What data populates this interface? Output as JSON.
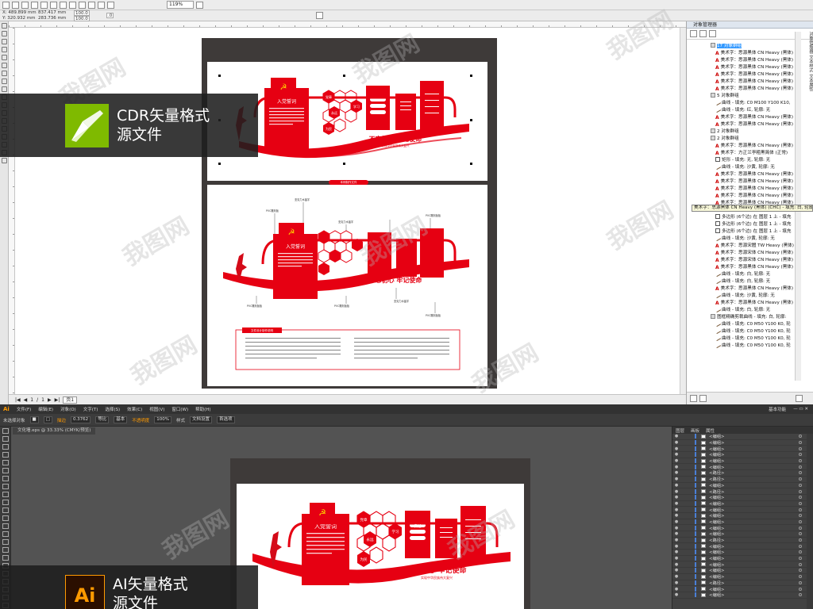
{
  "cdr": {
    "zoom": "119%",
    "coords": {
      "x": "X: 489.899 mm",
      "y": "Y: 320.932 mm",
      "w": "837.417 mm",
      "h": "283.736 mm"
    },
    "scale_a": "100.0",
    "scale_b": "100.0",
    "angle": ".0",
    "page_nav": {
      "current": "1",
      "separator": "/",
      "total": "1",
      "tab": "页1"
    },
    "object_manager": {
      "title": "对象管理器",
      "side_tabs": "对象管理器 文本样式 文本属性",
      "rows": [
        {
          "kind": "grp",
          "icon": "g",
          "text": "17 对象群组",
          "selected": true
        },
        {
          "kind": "item",
          "icon": "a",
          "text": "美术字：思源黑体 CN Heavy (黑体)"
        },
        {
          "kind": "item",
          "icon": "a",
          "text": "美术字：思源黑体 CN Heavy (黑体)"
        },
        {
          "kind": "item",
          "icon": "a",
          "text": "美术字：思源黑体 CN Heavy (黑体)"
        },
        {
          "kind": "item",
          "icon": "a",
          "text": "美术字：思源黑体 CN Heavy (黑体)"
        },
        {
          "kind": "item",
          "icon": "a",
          "text": "美术字：思源黑体 CN Heavy (黑体)"
        },
        {
          "kind": "item",
          "icon": "a",
          "text": "美术字：思源黑体 CN Heavy (黑体)"
        },
        {
          "kind": "grp",
          "icon": "g",
          "text": "5 对象群组"
        },
        {
          "kind": "item",
          "icon": "c",
          "text": "曲线 - 填充: C0 M100 Y100 K10,"
        },
        {
          "kind": "item",
          "icon": "c",
          "text": "曲线 - 填充: 红, 轮廓: 无"
        },
        {
          "kind": "item",
          "icon": "a",
          "text": "美术字：思源黑体 CN Heavy (黑体)"
        },
        {
          "kind": "item",
          "icon": "a",
          "text": "美术字：思源黑体 CN Heavy (黑体)"
        },
        {
          "kind": "grp",
          "icon": "g",
          "text": "2 对象群组"
        },
        {
          "kind": "grp",
          "icon": "g",
          "text": "2 对象群组"
        },
        {
          "kind": "item",
          "icon": "a",
          "text": "美术字：思源黑体 CN Heavy (黑体)"
        },
        {
          "kind": "item",
          "icon": "a",
          "text": "美术字：方正兰亭粗黑简体 (正常)"
        },
        {
          "kind": "item",
          "icon": "r",
          "text": "矩形 - 填充: 无, 轮廓: 无"
        },
        {
          "kind": "item",
          "icon": "c",
          "text": "曲线 - 填充: 沙黄, 轮廓: 无"
        },
        {
          "kind": "item",
          "icon": "a",
          "text": "美术字：思源黑体 CN Heavy (黑体)"
        },
        {
          "kind": "item",
          "icon": "a",
          "text": "美术字：思源黑体 CN Heavy (黑体)"
        },
        {
          "kind": "item",
          "icon": "a",
          "text": "美术字：思源黑体 CN Heavy (黑体)"
        },
        {
          "kind": "item",
          "icon": "a",
          "text": "美术字：思源黑体 CN Heavy (黑体)"
        },
        {
          "kind": "item",
          "icon": "a",
          "text": "美术字：思源黑体 CN Heavy (黑体)"
        },
        {
          "kind": "item",
          "icon": "a",
          "text": "美术字：思源黑体 CN Heavy (黑体)"
        },
        {
          "kind": "item",
          "icon": "h",
          "text": "多边形 (6个边) 在 图层 1 上 - 填充"
        },
        {
          "kind": "item",
          "icon": "h",
          "text": "多边形 (6个边) 在 图层 1 上 - 填充"
        },
        {
          "kind": "item",
          "icon": "h",
          "text": "多边形 (6个边) 在 图层 1 上 - 填充"
        },
        {
          "kind": "item",
          "icon": "c",
          "text": "曲线 - 填充: 沙黄, 轮廓: 无"
        },
        {
          "kind": "item",
          "icon": "a",
          "text": "美术字：思源宋體 TW Heavy (黑体)"
        },
        {
          "kind": "item",
          "icon": "a",
          "text": "美术字：思源宋体 CN Heavy (黑体)"
        },
        {
          "kind": "item",
          "icon": "a",
          "text": "美术字：思源宋体 CN Heavy (黑体)"
        },
        {
          "kind": "item",
          "icon": "a",
          "text": "美术字：思源黑体 CN Heavy (黑体)"
        },
        {
          "kind": "item",
          "icon": "c",
          "text": "曲线 - 填充: 白, 轮廓: 无"
        },
        {
          "kind": "item",
          "icon": "c",
          "text": "曲线 - 填充: 白, 轮廓: 无"
        },
        {
          "kind": "item",
          "icon": "a",
          "text": "美术字：思源黑体 CN Heavy (黑体)"
        },
        {
          "kind": "item",
          "icon": "c",
          "text": "曲线 - 填充: 沙黄, 轮廓: 无"
        },
        {
          "kind": "item",
          "icon": "a",
          "text": "美术字：思源黑体 CN Heavy (黑体)"
        },
        {
          "kind": "item",
          "icon": "c",
          "text": "曲线 - 填充: 白, 轮廓: 无"
        },
        {
          "kind": "grp",
          "icon": "g",
          "text": "图框精确剪裁曲线 - 填充: 白, 轮廓:"
        },
        {
          "kind": "item",
          "icon": "c",
          "text": "曲线 - 填充: C0 M50 Y100 K0, 轮"
        },
        {
          "kind": "item",
          "icon": "c",
          "text": "曲线 - 填充: C0 M50 Y100 K0, 轮"
        },
        {
          "kind": "item",
          "icon": "c",
          "text": "曲线 - 填充: C0 M50 Y100 K0, 轮"
        },
        {
          "kind": "item",
          "icon": "c",
          "text": "曲线 - 填充: C0 M50 Y100 K0, 轮"
        }
      ],
      "tooltip": "美术字：思源黑体 CN Heavy (黑体) (CHC) - 填充: 白, 轮廓: 无"
    }
  },
  "design": {
    "panel_title": "入党誓词",
    "slogan": "不忘初心 牢记使命",
    "slogan_sub": "实现中华民族伟大复兴",
    "hex_words": [
      "党章",
      "学习",
      "永远",
      "为民",
      "责任"
    ],
    "annotations": {
      "pvc_top": "PVC雕刻板",
      "acrylic_a": "亚克力水晶字",
      "acrylic_b": "亚克力水晶字",
      "pvc_right": "PVC雕刻板板",
      "pvc_bottom_left": "PVC雕刻板板",
      "pvc_bottom_mid": "PVC雕刻板板",
      "acrylic_c": "亚克力水晶字",
      "pvc_bottom_right": "PVC雕刻板板"
    },
    "separator_label": "本例制作文件",
    "notes_title": "文件设计制作说明"
  },
  "overlays": {
    "cdr_line1": "CDR矢量格式",
    "cdr_line2": "源文件",
    "ai_line1": "AI矢量格式",
    "ai_line2": "源文件"
  },
  "ai": {
    "logo": "Ai",
    "menus": [
      "文件(F)",
      "编辑(E)",
      "对象(O)",
      "文字(T)",
      "选择(S)",
      "效果(C)",
      "视图(V)",
      "窗口(W)",
      "帮助(H)"
    ],
    "workspace": "基本功能",
    "ctrl": {
      "selection": "未选择对象",
      "stroke": "描边",
      "stroke_val": "0.3762",
      "brush": "等比",
      "style": "基本",
      "opacity_label": "不透明度",
      "opacity": "100%",
      "style_label": "样式",
      "doc_setup": "文档设置",
      "prefs": "首选项"
    },
    "doc_tab": "文化墙.eps @ 33.33% (CMYK/预览)",
    "layers_tabs": [
      "图层",
      "画板",
      "属性"
    ],
    "layer_rows": [
      "<编组>",
      "<编组>",
      "<编组>",
      "<编组>",
      "<编组>",
      "<编组>",
      "<路径>",
      "<路径>",
      "<编组>",
      "<路径>",
      "<编组>",
      "<编组>",
      "<编组>",
      "<编组>",
      "<编组>",
      "<编组>",
      "<编组>",
      "<路径>",
      "<编组>",
      "<编组>",
      "<编组>",
      "<编组>",
      "<编组>",
      "<编组>",
      "<路径>",
      "<编组>",
      "<编组>"
    ]
  },
  "watermark": "我图网"
}
